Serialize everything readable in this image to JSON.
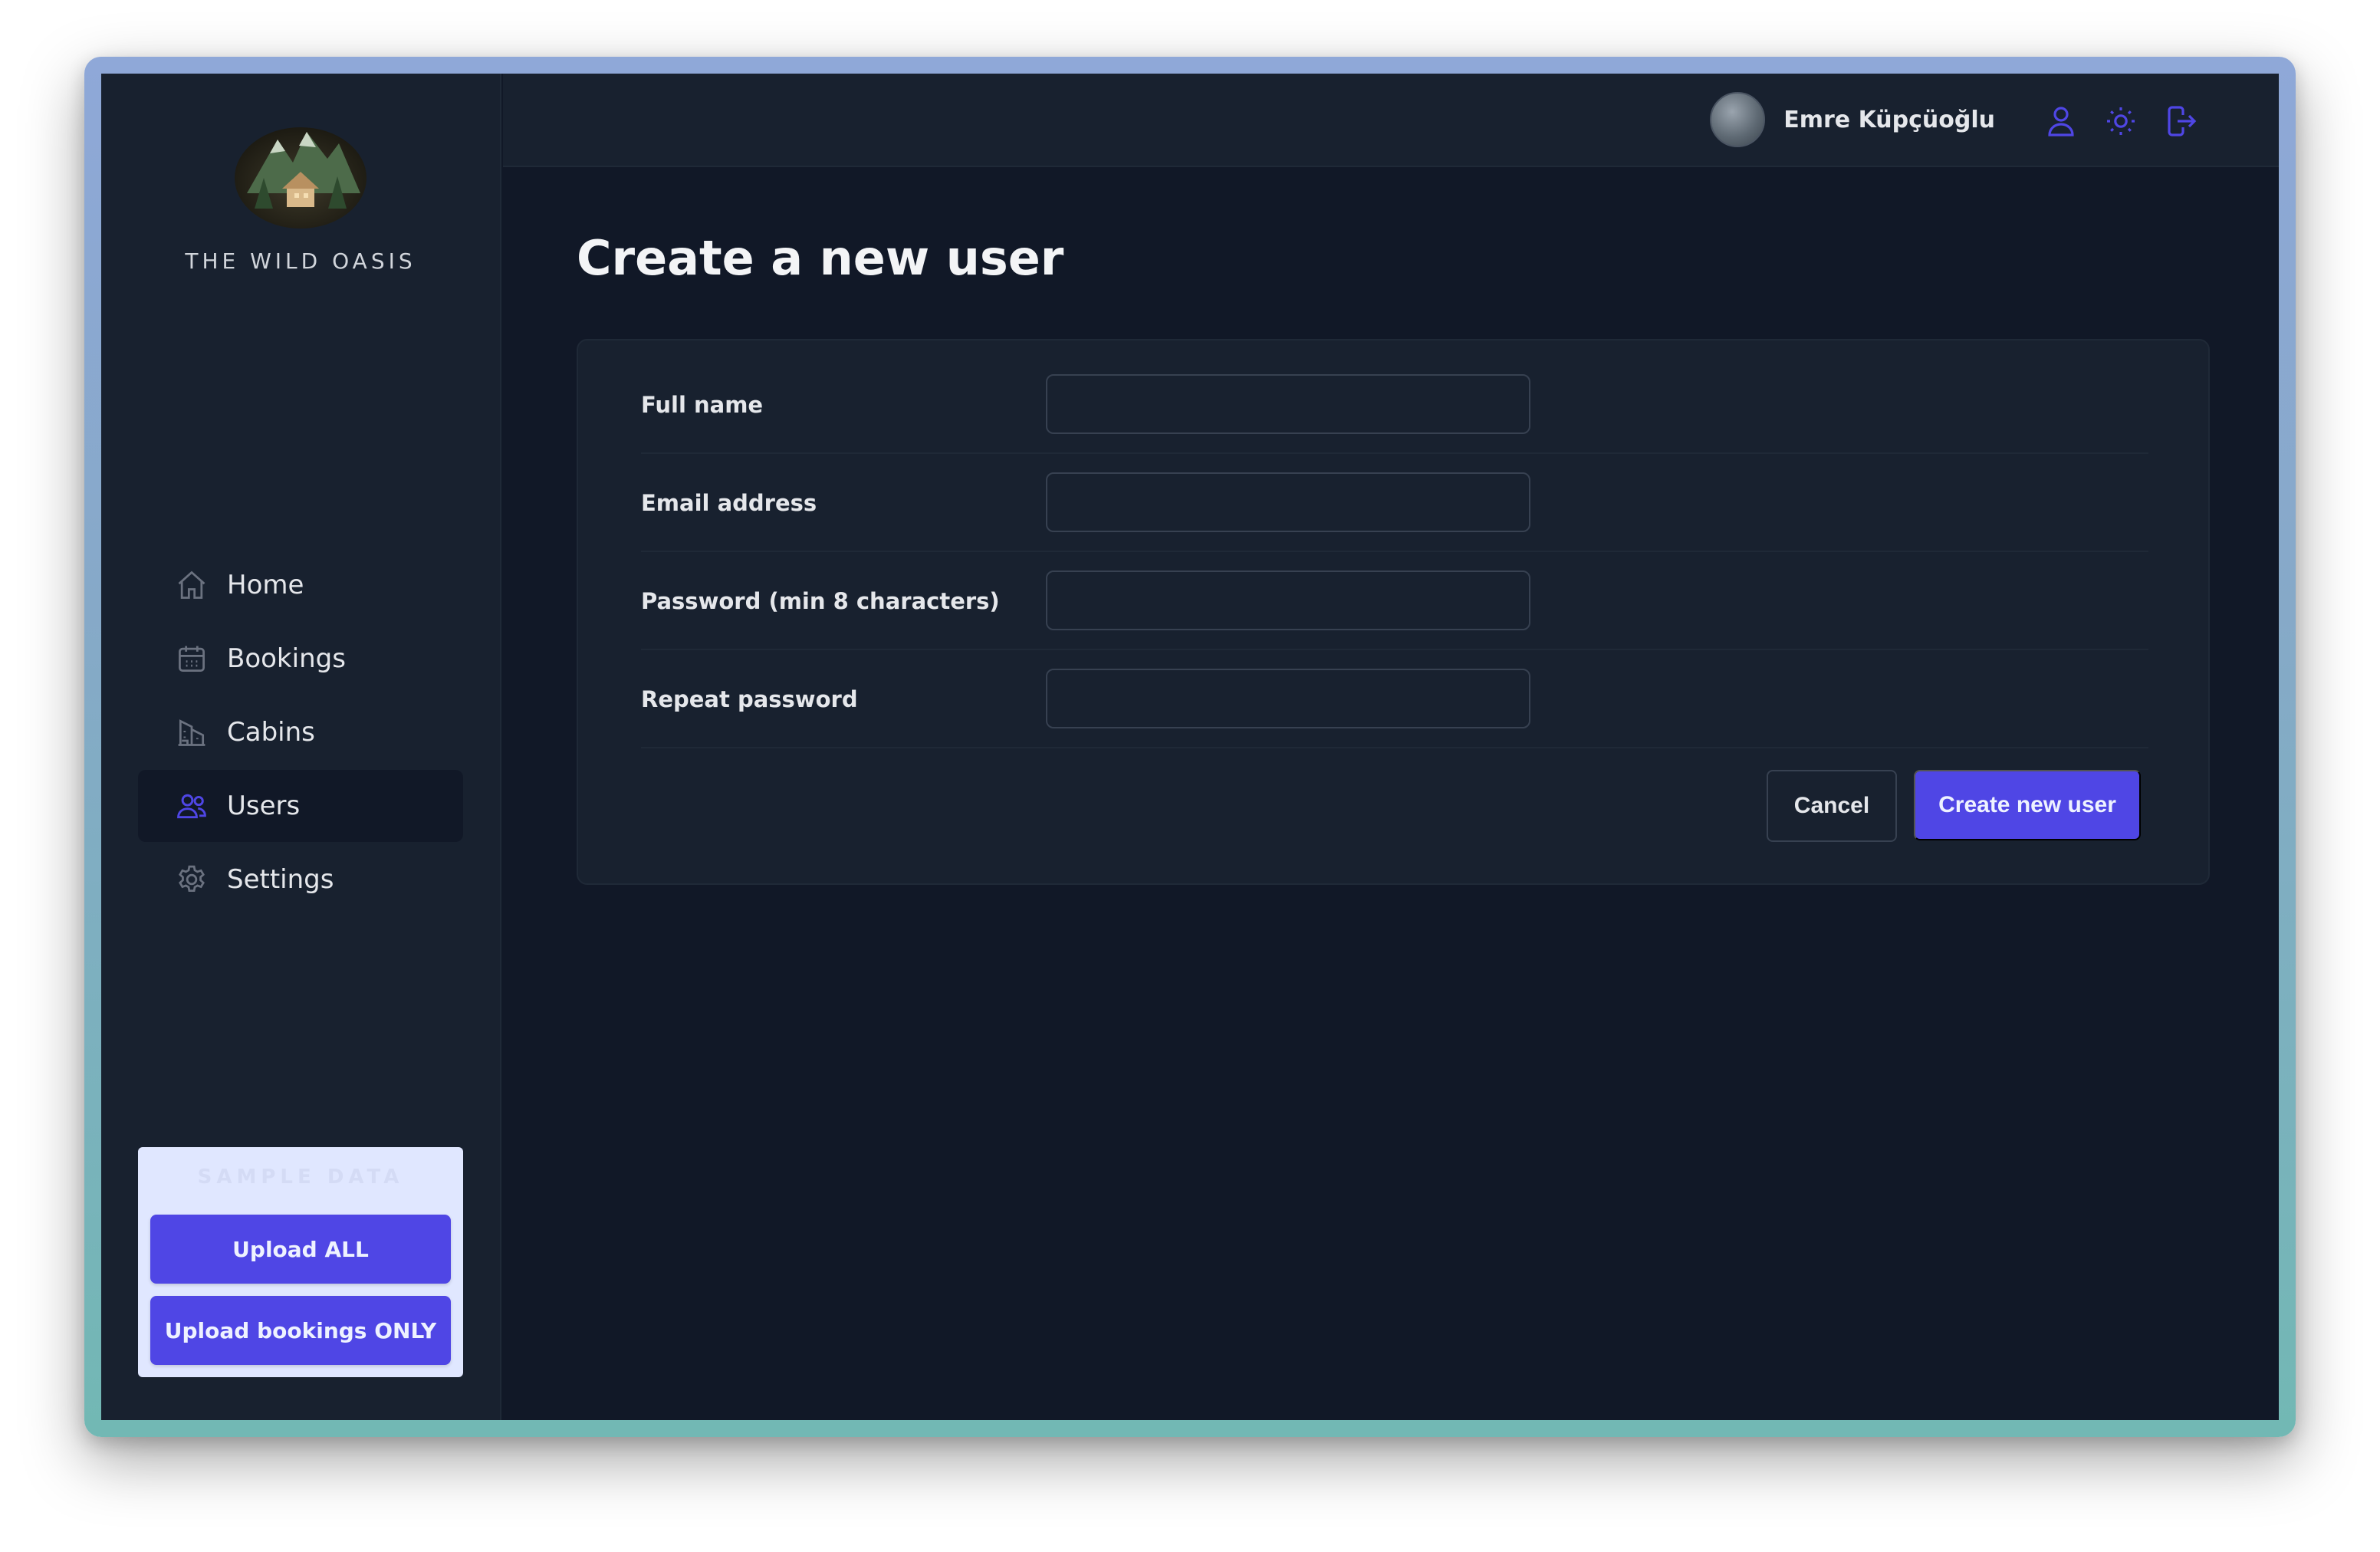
{
  "brand": {
    "name": "THE WILD OASIS"
  },
  "sidebar": {
    "items": [
      {
        "label": "Home",
        "icon": "home-icon"
      },
      {
        "label": "Bookings",
        "icon": "calendar-icon"
      },
      {
        "label": "Cabins",
        "icon": "building-icon"
      },
      {
        "label": "Users",
        "icon": "users-icon",
        "active": true
      },
      {
        "label": "Settings",
        "icon": "gear-icon"
      }
    ],
    "sample_data": {
      "title": "SAMPLE DATA",
      "upload_all": "Upload ALL",
      "upload_bookings": "Upload bookings ONLY"
    }
  },
  "header": {
    "user_name": "Emre Küpçüoğlu",
    "icons": [
      "user-icon",
      "sun-icon",
      "logout-icon"
    ]
  },
  "main": {
    "title": "Create a new user",
    "form": {
      "fields": [
        {
          "label": "Full name",
          "value": ""
        },
        {
          "label": "Email address",
          "value": ""
        },
        {
          "label": "Password (min 8 characters)",
          "value": ""
        },
        {
          "label": "Repeat password",
          "value": ""
        }
      ],
      "cancel_label": "Cancel",
      "submit_label": "Create new user"
    }
  },
  "colors": {
    "accent": "#4f46e5",
    "background": "#111827",
    "panel": "#18212f",
    "border": "#1f2937"
  }
}
